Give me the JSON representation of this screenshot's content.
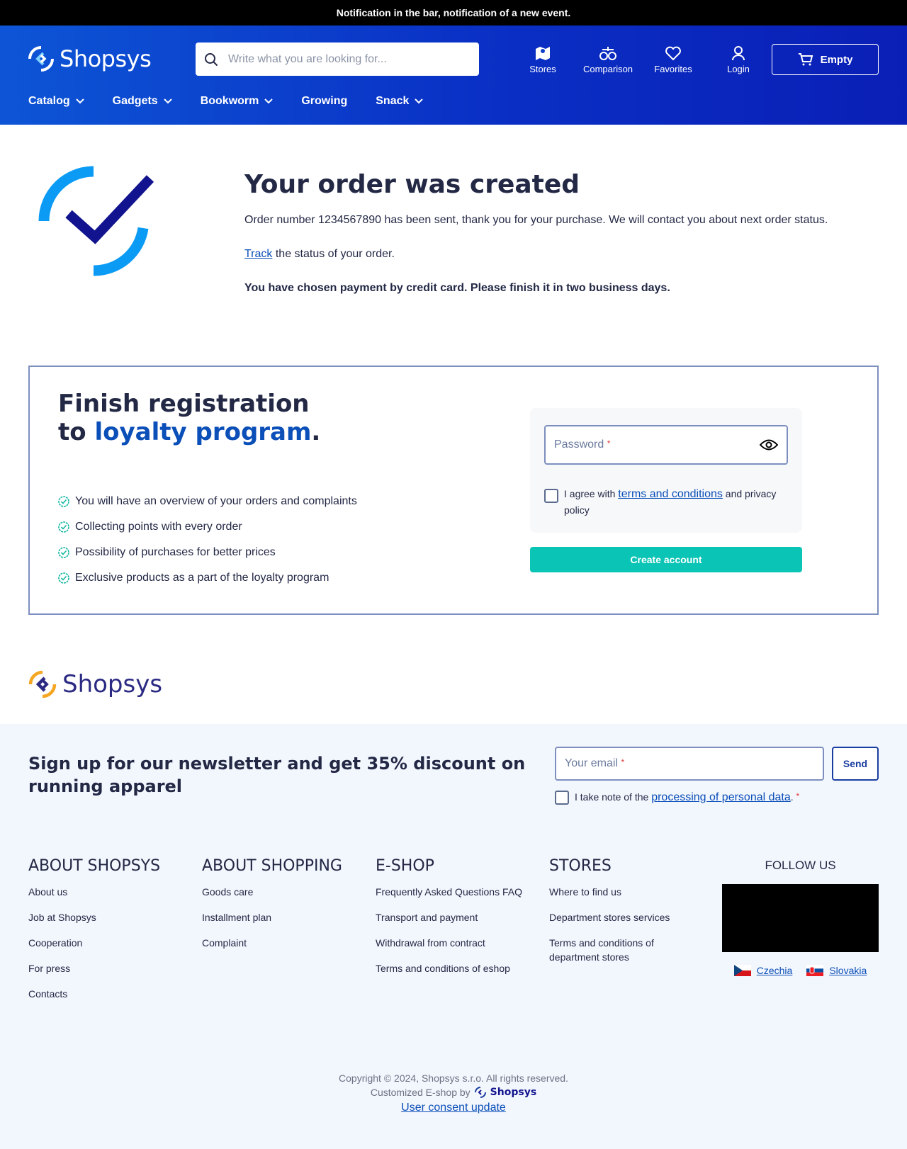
{
  "notification": "Notification in the bar, notification of a new event.",
  "header": {
    "logo": "Shopsys",
    "search_placeholder": "Write what you are looking for...",
    "icons": [
      {
        "label": "Stores",
        "icon": "map-icon"
      },
      {
        "label": "Comparison",
        "icon": "scales-icon"
      },
      {
        "label": "Favorites",
        "icon": "heart-icon"
      },
      {
        "label": "Login",
        "icon": "user-icon"
      }
    ],
    "cart_label": "Empty",
    "nav": [
      "Catalog",
      "Gadgets",
      "Bookworm",
      "Growing",
      "Snack"
    ]
  },
  "order": {
    "title": "Your order was created",
    "line1": "Order number 1234567890 has been sent, thank you for your purchase. We will contact you about next order status.",
    "track_link": "Track",
    "track_rest": " the status of your order.",
    "payment_note": "You have chosen payment by credit card. Please finish it in two business days."
  },
  "loyalty": {
    "title_part1": "Finish registration to ",
    "title_highlight": "loyalty program",
    "title_end": ".",
    "benefits": [
      "You will have an overview of your orders and complaints",
      "Collecting points with every order",
      "Possibility of purchases for better prices",
      "Exclusive products as a part of the loyalty program"
    ],
    "password_label": "Password",
    "required_mark": "*",
    "agree_prefix": "I agree with ",
    "agree_link": "terms and conditions",
    "agree_suffix": " and privacy policy",
    "create_button": "Create account"
  },
  "footer": {
    "logo": "Shopsys",
    "newsletter_title": "Sign up for our newsletter and get 35% discount on running apparel",
    "email_label": "Your email",
    "send_button": "Send",
    "nl_agree_prefix": "I take note of the ",
    "nl_agree_link": "processing of personal data",
    "nl_agree_suffix": ".",
    "columns": [
      {
        "title": "ABOUT SHOPSYS",
        "items": [
          "About us",
          "Job at Shopsys",
          "Cooperation",
          "For press",
          "Contacts"
        ]
      },
      {
        "title": "ABOUT SHOPPING",
        "items": [
          "Goods care",
          "Installment plan",
          "Complaint"
        ]
      },
      {
        "title": "E-SHOP",
        "items": [
          "Frequently Asked Questions FAQ",
          "Transport and payment",
          "Withdrawal from contract",
          "Terms and conditions of eshop"
        ]
      },
      {
        "title": "STORES",
        "items": [
          "Where to find us",
          "Department stores services",
          "Terms and conditions of department stores"
        ]
      }
    ],
    "follow_title": "FOLLOW US",
    "countries": [
      "Czechia",
      "Slovakia"
    ],
    "copyright": "Copyright © 2024, Shopsys s.r.o. All rights reserved.",
    "customized_by": "Customized E-shop by",
    "customized_logo": "Shopsys",
    "consent_link": "User consent update"
  },
  "colors": {
    "header_start": "#0d55d6",
    "header_end": "#0a1fb6",
    "accent": "#0b4fb8",
    "teal_button": "#0ac4b5",
    "check_green": "#16b8a3"
  }
}
